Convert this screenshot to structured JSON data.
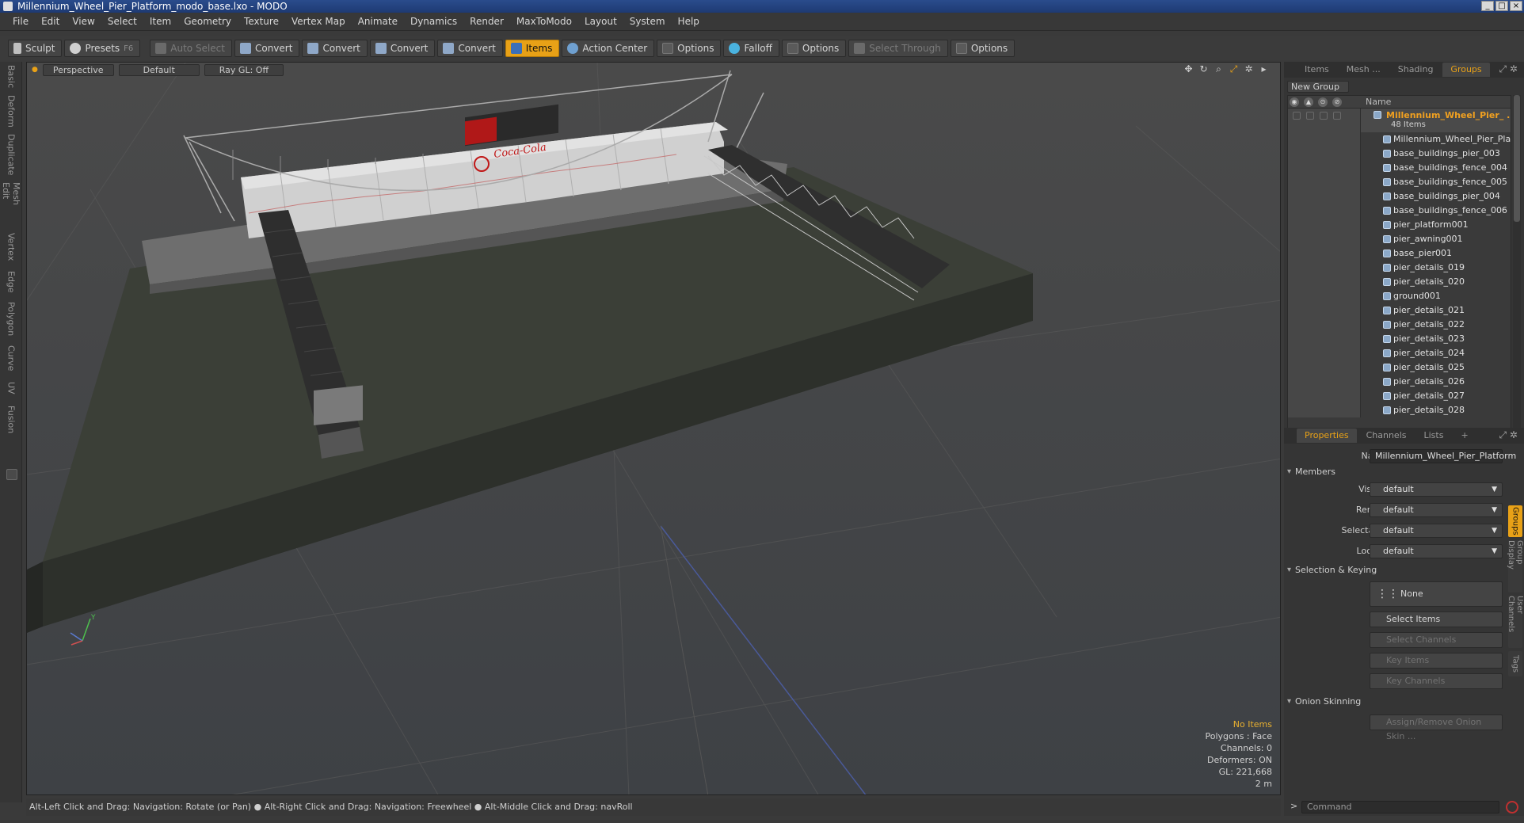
{
  "window": {
    "title": "Millennium_Wheel_Pier_Platform_modo_base.lxo - MODO",
    "controls": [
      "_",
      "□",
      "×"
    ]
  },
  "menu": [
    "File",
    "Edit",
    "View",
    "Select",
    "Item",
    "Geometry",
    "Texture",
    "Vertex Map",
    "Animate",
    "Dynamics",
    "Render",
    "MaxToModo",
    "Layout",
    "System",
    "Help"
  ],
  "toolbar": {
    "sculpt": "Sculpt",
    "presets": "Presets",
    "presets_key": "F6",
    "auto_select": "Auto Select",
    "convert1": "Convert",
    "convert2": "Convert",
    "convert3": "Convert",
    "convert4": "Convert",
    "items": "Items",
    "action_center": "Action Center",
    "options1": "Options",
    "falloff": "Falloff",
    "options2": "Options",
    "select_through": "Select Through",
    "options3": "Options"
  },
  "left_tabs": [
    "Basic",
    "Deform",
    "Duplicate",
    "Mesh Edit",
    "Vertex",
    "Edge",
    "Polygon",
    "Curve",
    "UV",
    "Fusion"
  ],
  "viewport": {
    "view": "Perspective",
    "shading": "Default",
    "raygl": "Ray GL: Off",
    "info": {
      "selection": "No Items",
      "polygons": "Polygons : Face",
      "channels": "Channels: 0",
      "deformers": "Deformers: ON",
      "gl": "GL: 221,668",
      "scale": "2 m"
    },
    "sign_text": "Coca-Cola",
    "axis_y": "Y"
  },
  "status_bar": "Alt-Left Click and Drag: Navigation: Rotate (or Pan) ● Alt-Right Click and Drag: Navigation: Freewheel ● Alt-Middle Click and Drag: navRoll",
  "groups_panel": {
    "tabs": [
      "Items",
      "Mesh ...",
      "Shading",
      "Groups"
    ],
    "active_tab": "Groups",
    "new_group": "New Group",
    "name_header": "Name",
    "group_name": "Millennium_Wheel_Pier_ ...",
    "group_count": "48 Items",
    "items": [
      "Millennium_Wheel_Pier_Pla ...",
      "base_buildings_pier_003",
      "base_buildings_fence_004",
      "base_buildings_fence_005",
      "base_buildings_pier_004",
      "base_buildings_fence_006",
      "pier_platform001",
      "pier_awning001",
      "base_pier001",
      "pier_details_019",
      "pier_details_020",
      "ground001",
      "pier_details_021",
      "pier_details_022",
      "pier_details_023",
      "pier_details_024",
      "pier_details_025",
      "pier_details_026",
      "pier_details_027",
      "pier_details_028"
    ]
  },
  "properties_panel": {
    "tabs": [
      "Properties",
      "Channels",
      "Lists",
      "+"
    ],
    "active_tab": "Properties",
    "name_label": "Name",
    "name_value": "Millennium_Wheel_Pier_Platform",
    "members_section": "Members",
    "visible_label": "Visible",
    "visible_value": "default",
    "render_label": "Render",
    "render_value": "default",
    "selectable_label": "Selectable",
    "selectable_value": "default",
    "locked_label": "Locked",
    "locked_value": "default",
    "selection_section": "Selection & Keying",
    "none_label": "None",
    "select_items": "Select Items",
    "select_channels": "Select Channels",
    "key_items": "Key Items",
    "key_channels": "Key Channels",
    "onion_section": "Onion Skinning",
    "onion_button": "Assign/Remove Onion Skin ...",
    "side_tabs": [
      "Groups",
      "Group Display",
      "User Channels",
      "Tags"
    ]
  },
  "command": {
    "prompt": ">",
    "placeholder": "Command"
  }
}
